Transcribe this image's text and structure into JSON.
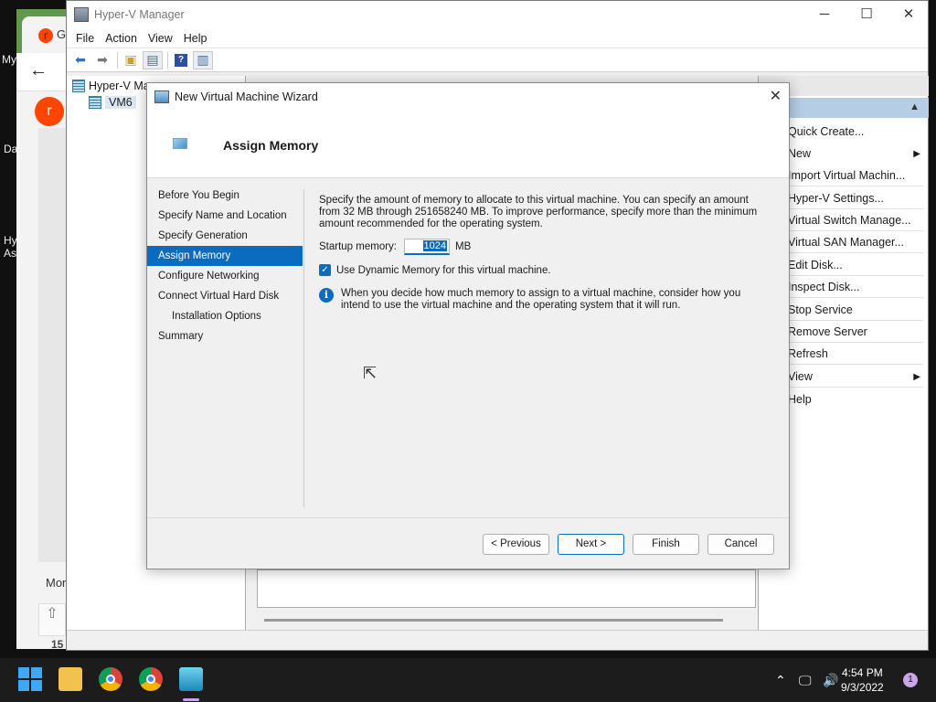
{
  "background_browser": {
    "tab_label": "G",
    "more_label": "Mor",
    "count_label": "15",
    "reddit_glyph": "r"
  },
  "desktop": {
    "labels": [
      "My",
      "Da",
      "Hy",
      "As"
    ]
  },
  "hyperv": {
    "title": "Hyper-V Manager",
    "menu": [
      "File",
      "Action",
      "View",
      "Help"
    ],
    "tree": {
      "root": "Hyper-V Ma",
      "vm": "VM6"
    },
    "actions_header": "ns",
    "actions": [
      "Quick Create...",
      "New",
      "Import Virtual Machin...",
      "Hyper-V Settings...",
      "Virtual Switch Manage...",
      "Virtual SAN Manager...",
      "Edit Disk...",
      "Inspect Disk...",
      "Stop Service",
      "Remove Server",
      "Refresh",
      "View",
      "Help"
    ],
    "window_controls": {
      "minimize": "─",
      "maximize": "☐",
      "close": "✕"
    }
  },
  "wizard": {
    "title": "New Virtual Machine Wizard",
    "close_glyph": "✕",
    "header": "Assign Memory",
    "steps": [
      "Before You Begin",
      "Specify Name and Location",
      "Specify Generation",
      "Assign Memory",
      "Configure Networking",
      "Connect Virtual Hard Disk",
      "Installation Options",
      "Summary"
    ],
    "active_step": "Assign Memory",
    "description": "Specify the amount of memory to allocate to this virtual machine. You can specify an amount from 32 MB through 251658240 MB. To improve performance, specify more than the minimum amount recommended for the operating system.",
    "startup_memory_label": "Startup memory:",
    "startup_memory_value": "1024",
    "startup_memory_unit": "MB",
    "dynamic_memory_label": "Use Dynamic Memory for this virtual machine.",
    "dynamic_memory_checked": true,
    "info_text": "When you decide how much memory to assign to a virtual machine, consider how you intend to use the virtual machine and the operating system that it will run.",
    "buttons": {
      "previous": "< Previous",
      "next": "Next >",
      "finish": "Finish",
      "cancel": "Cancel"
    }
  },
  "taskbar": {
    "time": "4:54 PM",
    "date": "9/3/2022",
    "notification_count": "1"
  },
  "colors": {
    "accent": "#0b6bbf",
    "actions_band": "#b6cde6",
    "reddit": "#ff4500"
  }
}
